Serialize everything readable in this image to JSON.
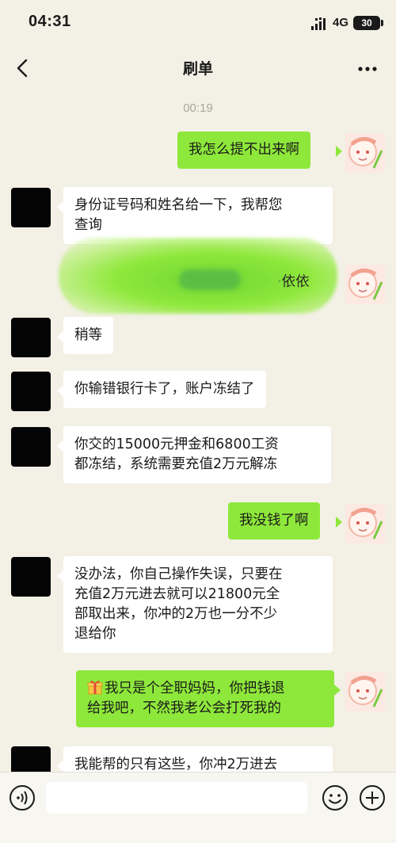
{
  "status_bar": {
    "time": "04:31",
    "network": "4G",
    "battery": "30"
  },
  "nav": {
    "title": "刷单",
    "back_icon": "chevron-left-icon",
    "more_icon": "more-dots-icon"
  },
  "timestamp": "00:19",
  "messages": [
    {
      "side": "right",
      "lines": [
        "我怎么提不出来啊"
      ]
    },
    {
      "side": "left",
      "lines": [
        "身份证号码和姓名给一下，我帮您",
        "查询"
      ]
    },
    {
      "side": "right",
      "redacted": true,
      "visible_fragment": "依依"
    },
    {
      "side": "left",
      "lines": [
        "稍等"
      ]
    },
    {
      "side": "left",
      "lines": [
        "你输错银行卡了，账户冻结了"
      ]
    },
    {
      "side": "left",
      "lines": [
        "你交的15000元押金和6800工资",
        "都冻结，系统需要充值2万元解冻"
      ]
    },
    {
      "side": "right",
      "lines": [
        "我没钱了啊"
      ]
    },
    {
      "side": "left",
      "lines": [
        "没办法，你自己操作失误，只要在",
        "充值2万元进去就可以21800元全",
        "部取出来，你冲的2万也一分不少",
        "退给你"
      ]
    },
    {
      "side": "right",
      "lines": [
        "我只是个全职妈妈，你把钱退",
        "给我吧，不然我老公会打死我的"
      ],
      "emoji": "gift-icon"
    },
    {
      "side": "left",
      "lines": [
        "我能帮的只有这些，你冲2万进去"
      ]
    }
  ],
  "input_bar": {
    "voice_icon": "voice-icon",
    "emoji_icon": "emoji-icon",
    "plus_icon": "plus-icon",
    "placeholder": ""
  },
  "colors": {
    "background": "#f3f1e6",
    "sent_bubble": "#8ee83b",
    "received_bubble": "#ffffff"
  }
}
